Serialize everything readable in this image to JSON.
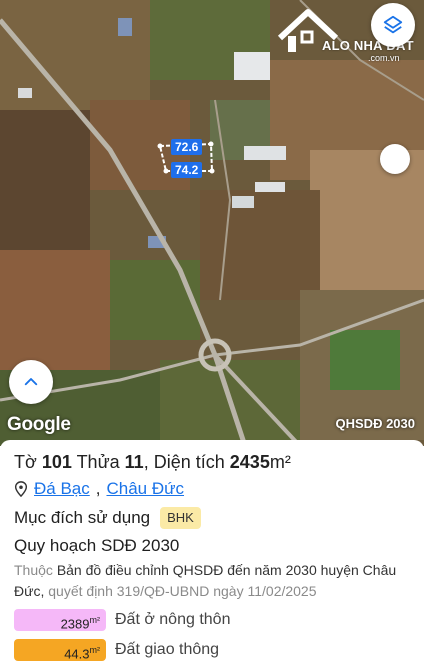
{
  "map": {
    "plot_label_top": "72.6",
    "plot_label_bottom": "74.2",
    "logo_text": "ALO NHÀ ĐẤT",
    "logo_sub": ".com.vn",
    "attribution": "Google",
    "layer_name": "QHSDĐ 2030",
    "icons": [
      "layers-icon",
      "chevron-up-icon"
    ]
  },
  "parcel": {
    "to_label": "Tờ",
    "to_value": "101",
    "thua_label": "Thửa",
    "thua_value": "11",
    "area_label": "Diện tích",
    "area_value": "2435",
    "area_unit": "m²",
    "location_icon": "location-pin-icon",
    "commune": "Đá Bạc",
    "district": "Châu Đức",
    "purpose_label": "Mục đích sử dụng",
    "purpose_code": "BHK"
  },
  "plan": {
    "title": "Quy hoạch SDĐ 2030",
    "desc_prefix": "Thuộc",
    "desc_main": "Bản đồ điều chỉnh QHSDĐ đến năm 2030 huyện Châu Đức,",
    "desc_suffix": "quyết định 319/QĐ-UBND ngày 11/02/2025",
    "areas": [
      {
        "value": "2389",
        "unit": "m²",
        "label": "Đất ở nông thôn",
        "color": "#f5b8f8"
      },
      {
        "value": "44.3",
        "unit": "m²",
        "label": "Đất giao thông",
        "color": "#f5a623"
      }
    ]
  }
}
